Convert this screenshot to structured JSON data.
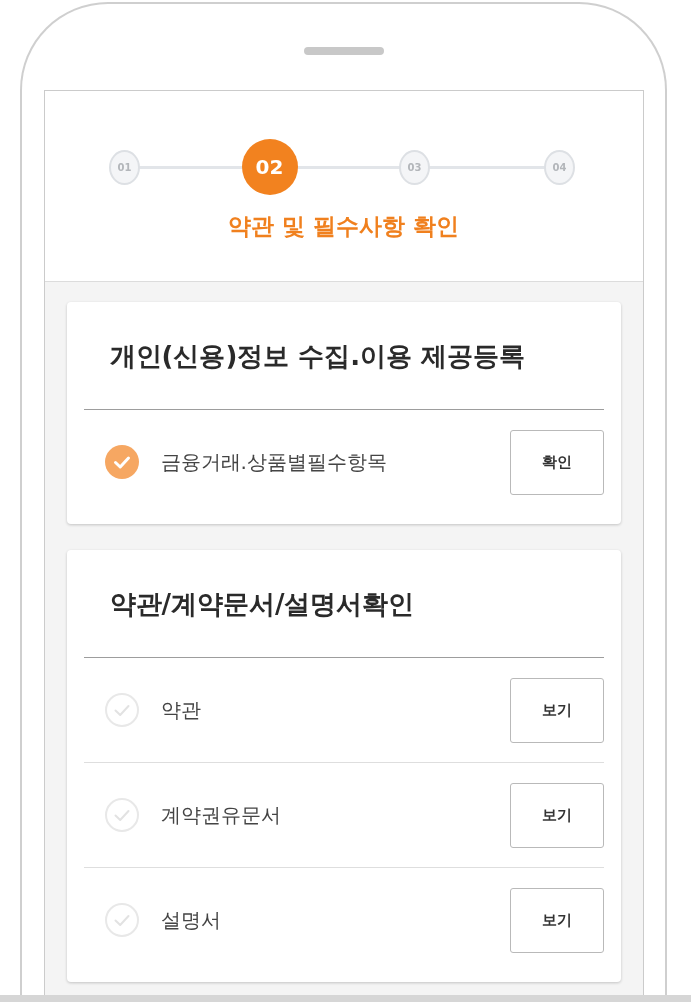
{
  "stepper": {
    "steps": [
      {
        "label": "01",
        "selected": false
      },
      {
        "label": "02",
        "selected": true
      },
      {
        "label": "03",
        "selected": false
      },
      {
        "label": "04",
        "selected": false
      }
    ],
    "title": "약관 및 필수사항 확인"
  },
  "sections": [
    {
      "title": "개인(신용)정보 수집.이용 제공등록",
      "items": [
        {
          "label": "금융거래.상품별필수항목",
          "checked": true,
          "button": "확인"
        }
      ]
    },
    {
      "title": "약관/계약문서/설명서확인",
      "items": [
        {
          "label": "약관",
          "checked": false,
          "button": "보기"
        },
        {
          "label": "계약권유문서",
          "checked": false,
          "button": "보기"
        },
        {
          "label": "설명서",
          "checked": false,
          "button": "보기"
        }
      ]
    }
  ]
}
